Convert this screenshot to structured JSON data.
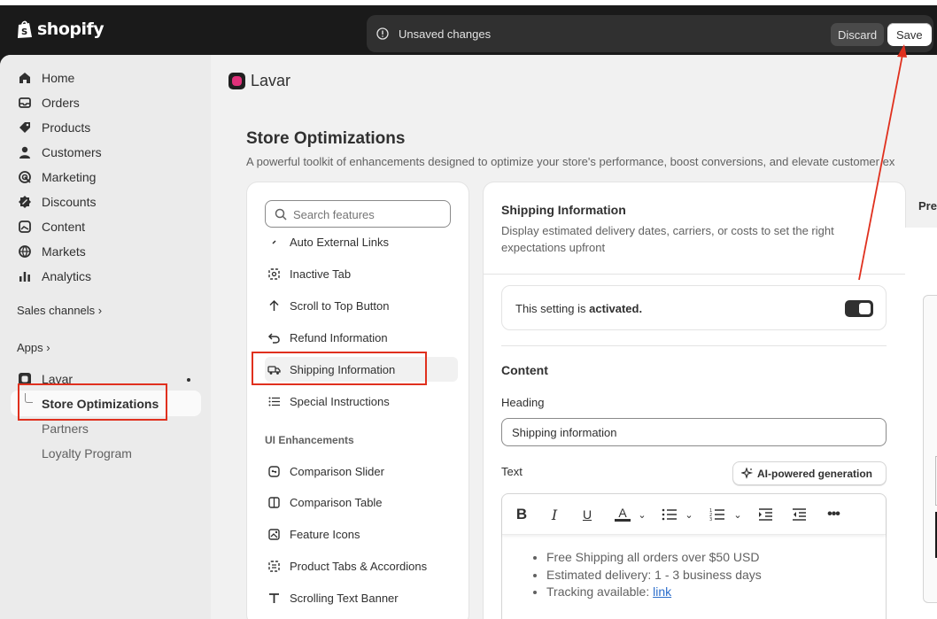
{
  "topbar": {
    "brand": "shopify",
    "unsaved_message": "Unsaved changes",
    "discard_label": "Discard",
    "save_label": "Save"
  },
  "sidebar": {
    "items": [
      {
        "label": "Home",
        "icon": "home-icon"
      },
      {
        "label": "Orders",
        "icon": "inbox-icon"
      },
      {
        "label": "Products",
        "icon": "tag-icon"
      },
      {
        "label": "Customers",
        "icon": "person-icon"
      },
      {
        "label": "Marketing",
        "icon": "target-icon"
      },
      {
        "label": "Discounts",
        "icon": "discount-icon"
      },
      {
        "label": "Content",
        "icon": "image-icon"
      },
      {
        "label": "Markets",
        "icon": "globe-icon"
      },
      {
        "label": "Analytics",
        "icon": "bar-chart-icon"
      }
    ],
    "sales_channels": "Sales channels",
    "apps": "Apps",
    "app_name": "Lavar",
    "sub_items": [
      "Store Optimizations",
      "Partners",
      "Loyalty Program"
    ]
  },
  "main": {
    "app_title": "Lavar",
    "page_title": "Store Optimizations",
    "page_subtitle": "A powerful toolkit of enhancements designed to optimize your store's performance, boost conversions, and elevate customer ex",
    "search_placeholder": "Search features",
    "features": [
      {
        "label": "Auto External Links",
        "icon": "link-icon"
      },
      {
        "label": "Inactive Tab",
        "icon": "tab-icon"
      },
      {
        "label": "Scroll to Top Button",
        "icon": "arrow-up-icon"
      },
      {
        "label": "Refund Information",
        "icon": "undo-icon"
      },
      {
        "label": "Shipping Information",
        "icon": "truck-icon"
      },
      {
        "label": "Special Instructions",
        "icon": "list-icon"
      }
    ],
    "group_heading": "UI Enhancements",
    "ui_features": [
      {
        "label": "Comparison Slider",
        "icon": "compare-icon"
      },
      {
        "label": "Comparison Table",
        "icon": "columns-icon"
      },
      {
        "label": "Feature Icons",
        "icon": "icons-icon"
      },
      {
        "label": "Product Tabs & Accordions",
        "icon": "tabs-icon"
      },
      {
        "label": "Scrolling Text Banner",
        "icon": "text-icon"
      }
    ]
  },
  "settings": {
    "title": "Shipping Information",
    "description": "Display estimated delivery dates, carriers, or costs to set the right expectations upfront",
    "activated_prefix": "This setting is",
    "activated_state": "activated.",
    "content_heading": "Content",
    "heading_label": "Heading",
    "heading_value": "Shipping information",
    "text_label": "Text",
    "ai_button": "AI-powered generation",
    "editor_lines": [
      "Free Shipping all orders over $50 USD",
      "Estimated delivery: 1 - 3 business days",
      "Tracking available:"
    ],
    "editor_link": "link"
  },
  "preview": {
    "label": "Pre"
  },
  "colors": {
    "highlight": "#e0301e",
    "topbar": "#1a1a1a",
    "link": "#2c6ecb"
  }
}
